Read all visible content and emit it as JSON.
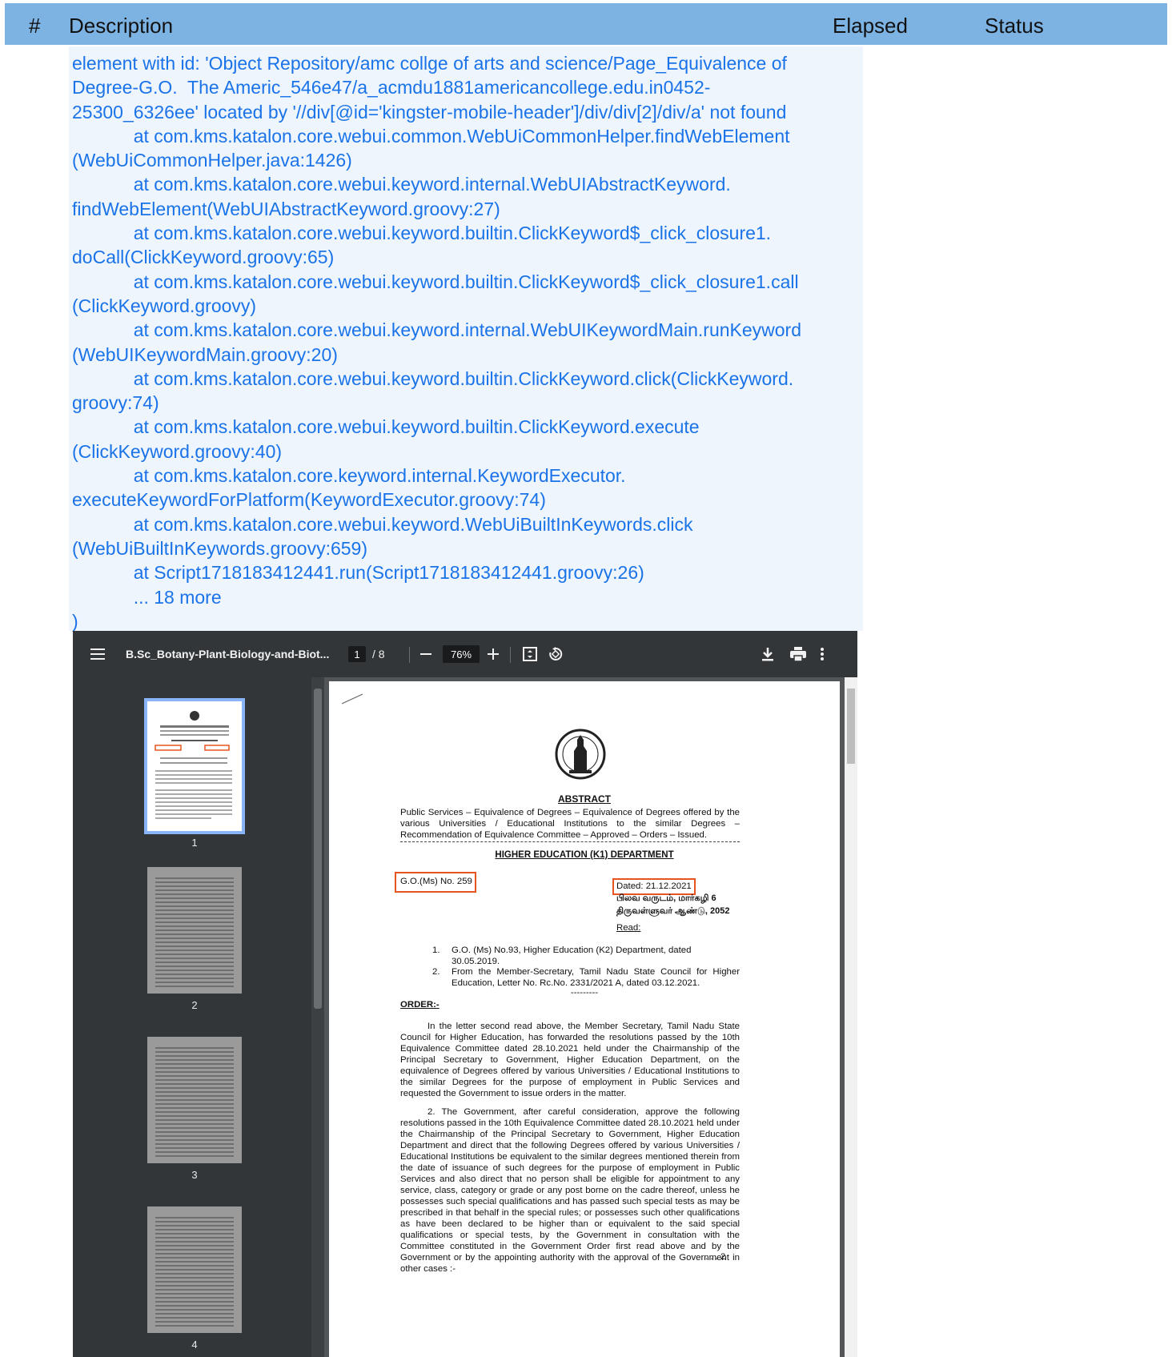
{
  "table_header": {
    "num": "#",
    "description": "Description",
    "elapsed": "Elapsed",
    "status": "Status"
  },
  "error_text": "element with id: 'Object Repository/amc collge of arts and science/Page_Equivalence of\nDegree-G.O.  The Americ_546e47/a_acmdu1881americancollege.edu.in0452-\n25300_6326ee' located by '//div[@id='kingster-mobile-header']/div/div[2]/div/a' not found\n            at com.kms.katalon.core.webui.common.WebUiCommonHelper.findWebElement\n(WebUiCommonHelper.java:1426)\n            at com.kms.katalon.core.webui.keyword.internal.WebUIAbstractKeyword.\nfindWebElement(WebUIAbstractKeyword.groovy:27)\n            at com.kms.katalon.core.webui.keyword.builtin.ClickKeyword$_click_closure1.\ndoCall(ClickKeyword.groovy:65)\n            at com.kms.katalon.core.webui.keyword.builtin.ClickKeyword$_click_closure1.call\n(ClickKeyword.groovy)\n            at com.kms.katalon.core.webui.keyword.internal.WebUIKeywordMain.runKeyword\n(WebUIKeywordMain.groovy:20)\n            at com.kms.katalon.core.webui.keyword.builtin.ClickKeyword.click(ClickKeyword.\ngroovy:74)\n            at com.kms.katalon.core.webui.keyword.builtin.ClickKeyword.execute\n(ClickKeyword.groovy:40)\n            at com.kms.katalon.core.keyword.internal.KeywordExecutor.\nexecuteKeywordForPlatform(KeywordExecutor.groovy:74)\n            at com.kms.katalon.core.webui.keyword.WebUiBuiltInKeywords.click\n(WebUiBuiltInKeywords.groovy:659)\n            at Script1718183412441.run(Script1718183412441.groovy:26)\n            ... 18 more\n)",
  "pdf": {
    "filename": "B.Sc_Botany-Plant-Biology-and-Biot...",
    "current_page": "1",
    "total_pages": "/ 8",
    "zoom": "76%",
    "icons": [
      "menu-icon",
      "minus-icon",
      "plus-icon",
      "fit-page-icon",
      "rotate-icon",
      "download-icon",
      "print-icon",
      "more-vert-icon"
    ],
    "thumbnails": [
      {
        "label": "1"
      },
      {
        "label": "2"
      },
      {
        "label": "3"
      },
      {
        "label": "4"
      }
    ],
    "document": {
      "heading": "ABSTRACT",
      "subject": "Public Services – Equivalence of Degrees – Equivalence of Degrees offered by the various Universities / Educational Institutions to the similar Degrees – Recommendation of Equivalence Committee – Approved – Orders – Issued.",
      "department": "HIGHER EDUCATION (K1) DEPARTMENT",
      "go_number": "G.O.(Ms) No. 259",
      "dated": "Dated:  21.12.2021",
      "tamil_line1": "பிலவ வருடம், மார்கழி 6",
      "tamil_line2": "திருவள்ளுவர் ஆண்டு, 2052",
      "read_label": "Read:",
      "ref1_num": "1.",
      "ref1": "G.O. (Ms) No.93, Higher Education (K2) Department, dated 30.05.2019.",
      "ref2_num": "2.",
      "ref2": "From the Member-Secretary, Tamil Nadu State Council for Higher Education, Letter No. Rc.No. 2331/2021 A, dated 03.12.2021.",
      "ref_sep": "---------",
      "order_label": "ORDER:-",
      "para1": "In the letter second read above, the Member Secretary, Tamil Nadu State Council for Higher Education,  has forwarded the resolutions passed by the 10th Equivalence Committee dated 28.10.2021 held under the Chairmanship of the Principal Secretary to Government, Higher Education Department, on the equivalence of Degrees offered by various Universities / Educational Institutions to the similar Degrees for the purpose of employment in Public Services and requested the Government to issue orders in the matter.",
      "para2": "2.     The Government, after careful consideration, approve the following resolutions passed in the 10th Equivalence Committee dated 28.10.2021 held under the Chairmanship of the Principal Secretary to Government, Higher Education Department and direct that the following Degrees offered by various Universities / Educational Institutions be equivalent to the similar degrees mentioned therein from the date of issuance of such degrees for the purpose of employment in Public Services and also direct that no person shall be eligible for appointment to any service, class, category or grade or any post borne on the cadre thereof, unless he possesses such special qualifications and has passed such special tests as may be prescribed in that behalf in the special rules; or possesses such other qualifications as have been declared to be higher than or equivalent to the said special qualifications or special tests, by the Government in consultation with the Committee constituted in the Government Order first read above and by the Government or by the appointing authority with the approval of the Government in other cases :-",
      "page_marker": ". . . 2"
    }
  },
  "colors": {
    "header_bg": "#7db3e3",
    "error_text": "#1a73e8",
    "error_bg": "#eef5fc",
    "highlight": "#e8541f"
  }
}
